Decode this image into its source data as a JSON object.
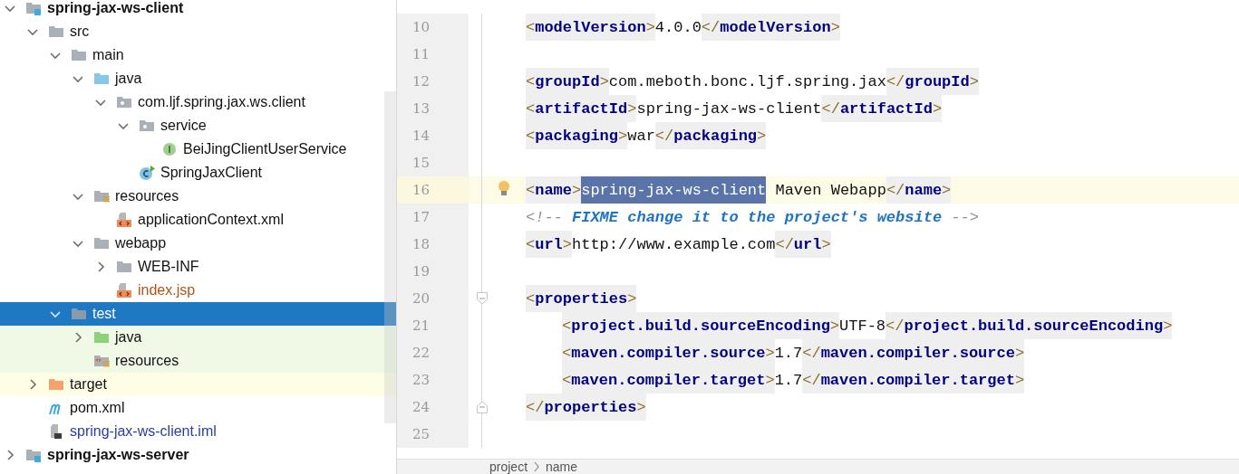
{
  "project_tree": [
    {
      "label": "spring-jax-ws-client",
      "kind": "module",
      "expanded": true,
      "selected": false,
      "children": [
        {
          "label": "src",
          "kind": "folder",
          "expanded": true,
          "selected": false,
          "children": [
            {
              "label": "main",
              "kind": "folder",
              "expanded": true,
              "selected": false,
              "children": [
                {
                  "label": "java",
                  "kind": "source-folder",
                  "expanded": true,
                  "selected": false,
                  "children": [
                    {
                      "label": "com.ljf.spring.jax.ws.client",
                      "kind": "package",
                      "expanded": true,
                      "selected": false,
                      "children": [
                        {
                          "label": "service",
                          "kind": "package",
                          "expanded": true,
                          "selected": false,
                          "children": [
                            {
                              "label": "BeiJingClientUserService",
                              "kind": "interface",
                              "selected": false
                            }
                          ]
                        },
                        {
                          "label": "SpringJaxClient",
                          "kind": "class",
                          "selected": false
                        }
                      ]
                    }
                  ]
                },
                {
                  "label": "resources",
                  "kind": "resources-folder",
                  "expanded": true,
                  "selected": false,
                  "children": [
                    {
                      "label": "applicationContext.xml",
                      "kind": "xml-file",
                      "selected": false
                    }
                  ]
                },
                {
                  "label": "webapp",
                  "kind": "folder",
                  "expanded": true,
                  "selected": false,
                  "children": [
                    {
                      "label": "WEB-INF",
                      "kind": "folder",
                      "expanded": false,
                      "selected": false
                    },
                    {
                      "label": "index.jsp",
                      "kind": "jsp-file",
                      "selected": false,
                      "color": "#b0541c"
                    }
                  ]
                }
              ]
            },
            {
              "label": "test",
              "kind": "folder",
              "expanded": true,
              "selected": true,
              "children": [
                {
                  "label": "java",
                  "kind": "test-source-folder",
                  "expanded": false,
                  "selected": false
                },
                {
                  "label": "resources",
                  "kind": "test-resources-folder",
                  "selected": false
                }
              ]
            }
          ]
        },
        {
          "label": "target",
          "kind": "excluded-folder",
          "expanded": false,
          "selected": false
        },
        {
          "label": "pom.xml",
          "kind": "maven-file",
          "selected": false
        },
        {
          "label": "spring-jax-ws-client.iml",
          "kind": "iml-file",
          "selected": false,
          "color": "#2a3ca6"
        }
      ]
    },
    {
      "label": "spring-jax-ws-server",
      "kind": "module",
      "expanded": false,
      "selected": false
    }
  ],
  "editor": {
    "lines": [
      {
        "number": "10",
        "tokens": [
          {
            "kind": "tag",
            "parts": [
              "<",
              "modelVersion",
              ">"
            ]
          },
          {
            "kind": "text",
            "text": "4.0.0"
          },
          {
            "kind": "tag",
            "parts": [
              "</",
              "modelVersion",
              ">"
            ]
          }
        ]
      },
      {
        "number": "11"
      },
      {
        "number": "12",
        "tokens": [
          {
            "kind": "tag",
            "parts": [
              "<",
              "groupId",
              ">"
            ]
          },
          {
            "kind": "text",
            "text": "com.meboth.bonc.ljf.spring.jax"
          },
          {
            "kind": "tag",
            "parts": [
              "</",
              "groupId",
              ">"
            ]
          }
        ]
      },
      {
        "number": "13",
        "tokens": [
          {
            "kind": "tag",
            "parts": [
              "<",
              "artifactId",
              ">"
            ]
          },
          {
            "kind": "text",
            "text": "spring-jax-ws-client"
          },
          {
            "kind": "tag",
            "parts": [
              "</",
              "artifactId",
              ">"
            ]
          }
        ]
      },
      {
        "number": "14",
        "tokens": [
          {
            "kind": "tag",
            "parts": [
              "<",
              "packaging",
              ">"
            ]
          },
          {
            "kind": "text",
            "text": "war"
          },
          {
            "kind": "tag",
            "parts": [
              "</",
              "packaging",
              ">"
            ]
          }
        ]
      },
      {
        "number": "15"
      },
      {
        "number": "16",
        "current": true,
        "intention": true,
        "tokens": [
          {
            "kind": "tag",
            "parts": [
              "<",
              "name",
              ">"
            ]
          },
          {
            "kind": "selection",
            "text": "spring-jax-ws-client"
          },
          {
            "kind": "text",
            "text": " Maven Webapp"
          },
          {
            "kind": "tag",
            "parts": [
              "</",
              "name",
              ">"
            ]
          }
        ]
      },
      {
        "number": "17",
        "tokens": [
          {
            "kind": "comment-mark",
            "text": "<!-- "
          },
          {
            "kind": "comment",
            "text": "FIXME change it to the project's website"
          },
          {
            "kind": "comment-mark",
            "text": " -->"
          }
        ]
      },
      {
        "number": "18",
        "tokens": [
          {
            "kind": "tag",
            "parts": [
              "<",
              "url",
              ">"
            ]
          },
          {
            "kind": "text",
            "text": "http://www.example.com"
          },
          {
            "kind": "tag",
            "parts": [
              "</",
              "url",
              ">"
            ]
          }
        ]
      },
      {
        "number": "19"
      },
      {
        "number": "20",
        "fold_start": true,
        "tokens": [
          {
            "kind": "tag",
            "parts": [
              "<",
              "properties",
              ">"
            ]
          }
        ]
      },
      {
        "number": "21",
        "indented": true,
        "tokens": [
          {
            "kind": "tag",
            "parts": [
              "<",
              "project.build.sourceEncoding",
              ">"
            ]
          },
          {
            "kind": "text",
            "text": "UTF-8"
          },
          {
            "kind": "tag",
            "parts": [
              "</",
              "project.build.sourceEncoding",
              ">"
            ]
          }
        ]
      },
      {
        "number": "22",
        "indented": true,
        "tokens": [
          {
            "kind": "tag",
            "parts": [
              "<",
              "maven.compiler.source",
              ">"
            ]
          },
          {
            "kind": "text",
            "text": "1.7"
          },
          {
            "kind": "tag",
            "parts": [
              "</",
              "maven.compiler.source",
              ">"
            ]
          }
        ]
      },
      {
        "number": "23",
        "indented": true,
        "tokens": [
          {
            "kind": "tag",
            "parts": [
              "<",
              "maven.compiler.target",
              ">"
            ]
          },
          {
            "kind": "text",
            "text": "1.7"
          },
          {
            "kind": "tag",
            "parts": [
              "</",
              "maven.compiler.target",
              ">"
            ]
          }
        ]
      },
      {
        "number": "24",
        "fold_end": true,
        "tokens": [
          {
            "kind": "tag",
            "parts": [
              "</",
              "properties",
              ">"
            ]
          }
        ]
      },
      {
        "number": "25"
      }
    ]
  },
  "breadcrumbs": [
    "project",
    "name"
  ]
}
